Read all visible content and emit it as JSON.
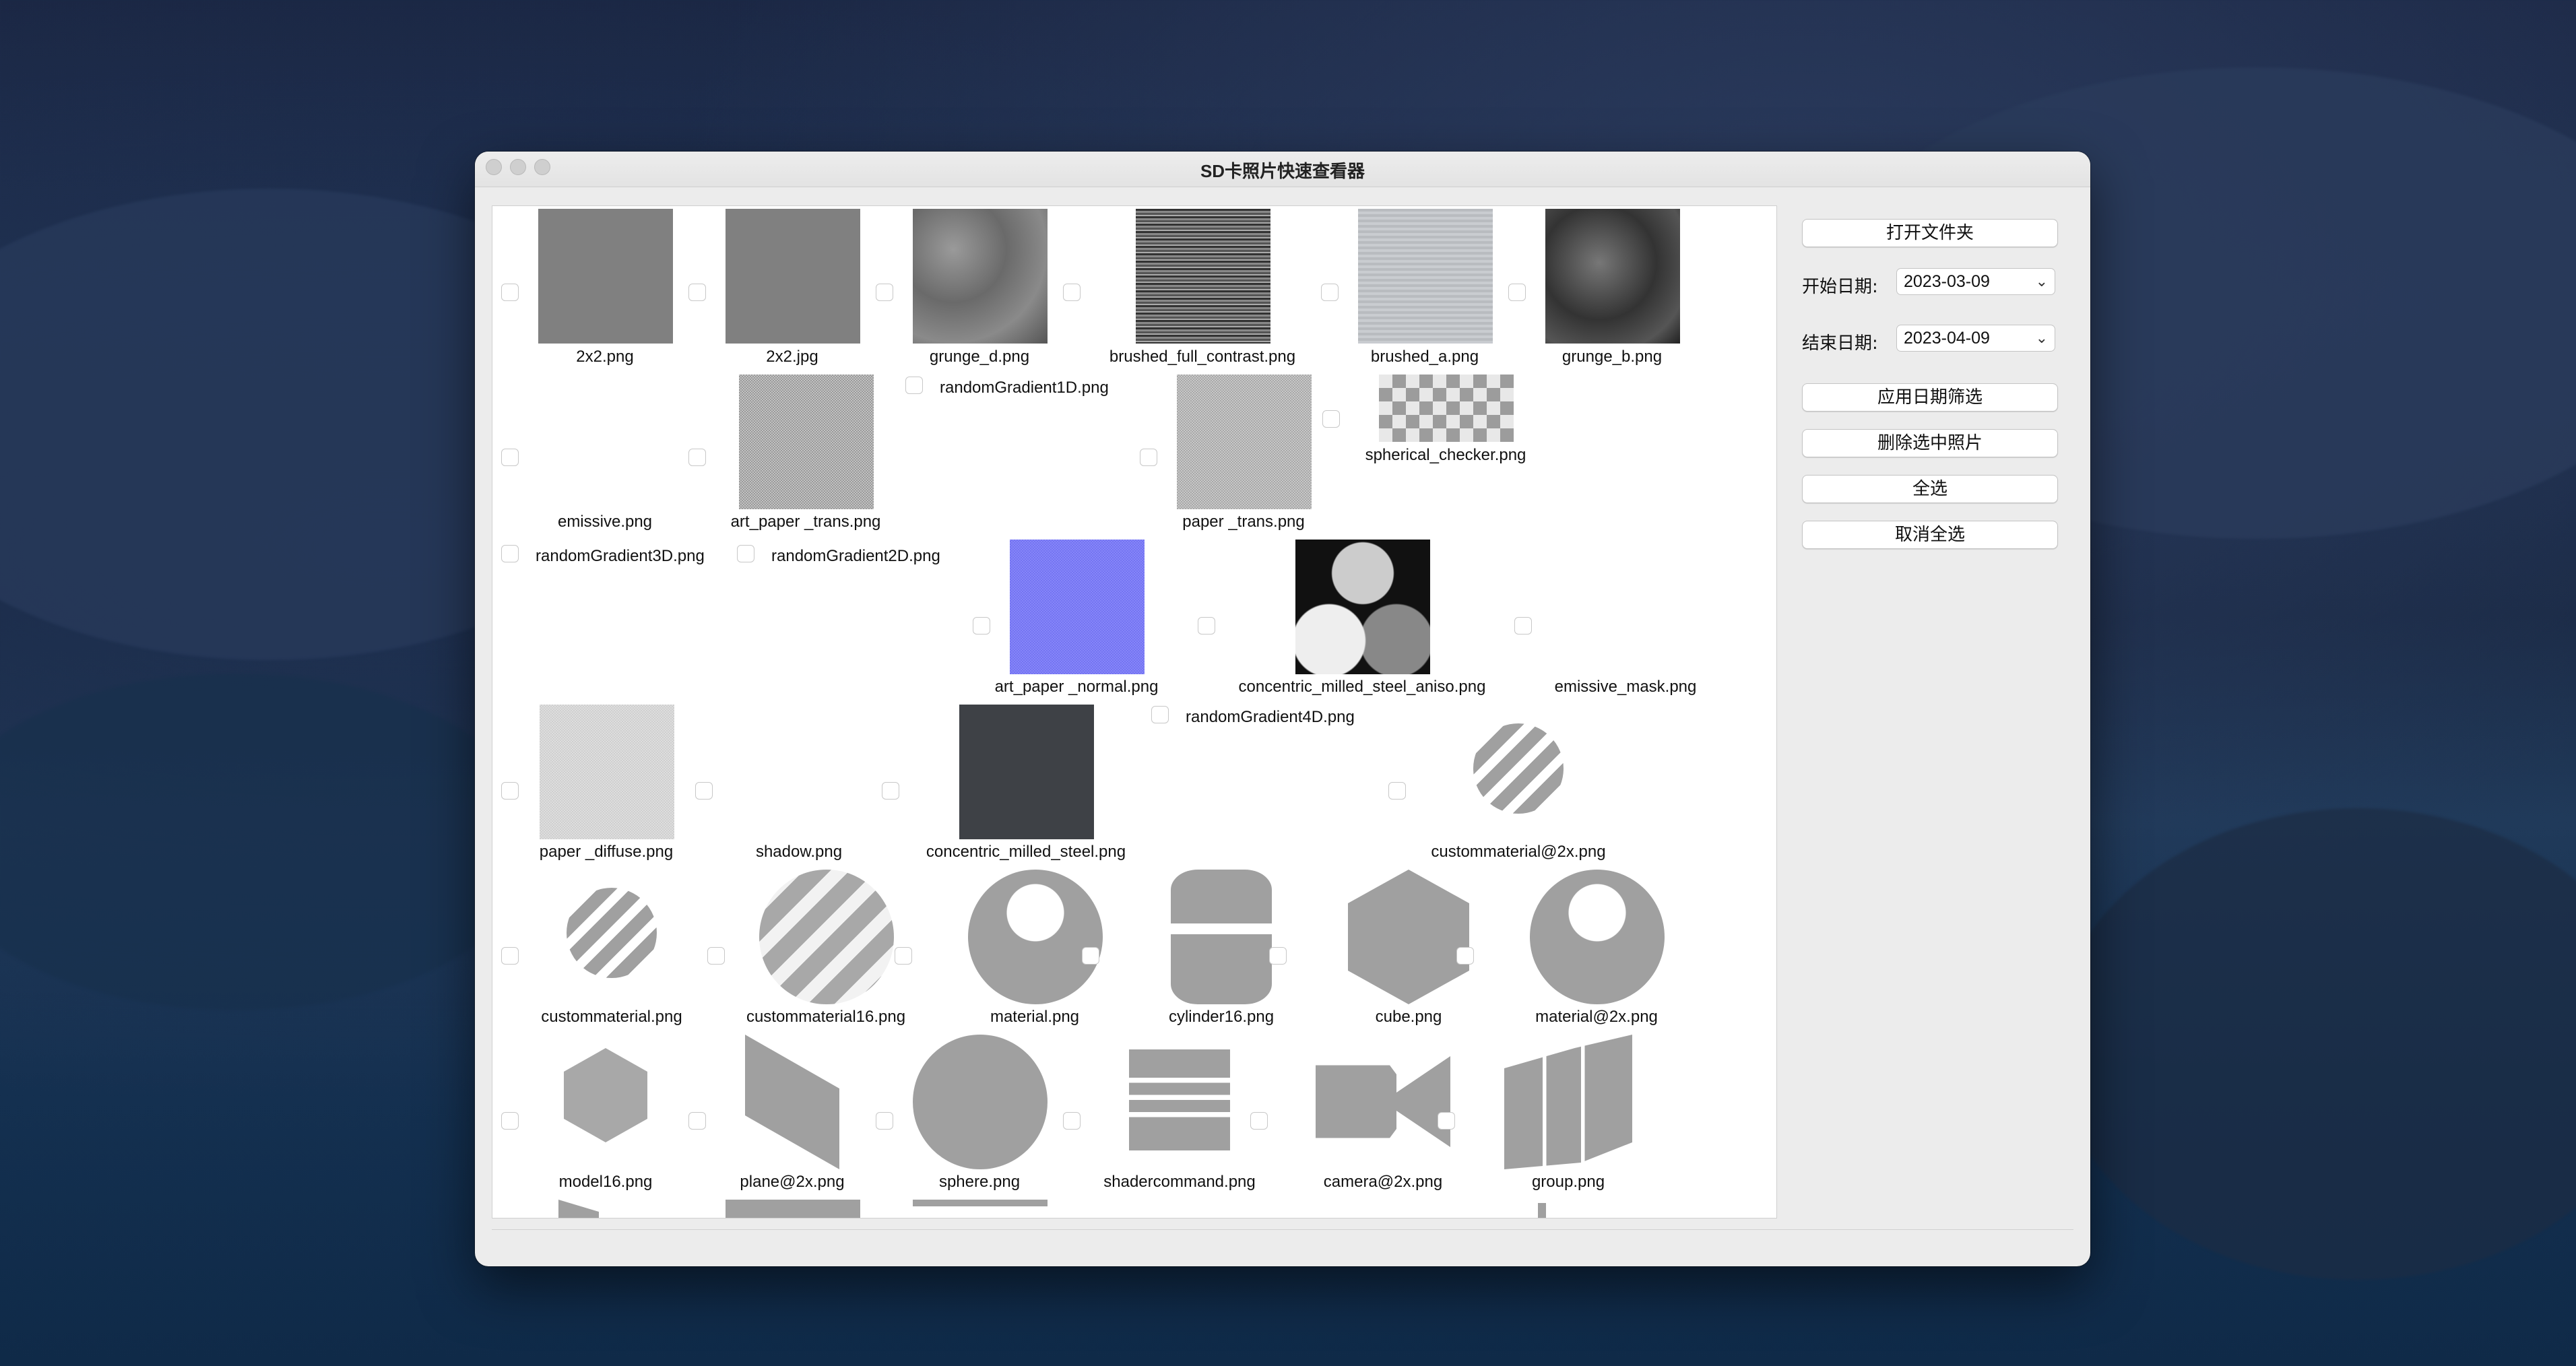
{
  "window": {
    "title": "SD卡照片快速查看器"
  },
  "controls": {
    "open_folder": "打开文件夹",
    "start_label": "开始日期:",
    "start_value": "2023-03-09",
    "end_label": "结束日期:",
    "end_value": "2023-04-09",
    "apply_filter": "应用日期筛选",
    "delete_selected": "删除选中照片",
    "select_all": "全选",
    "deselect_all": "取消全选"
  },
  "files": [
    "2x2.png",
    "2x2.jpg",
    "grunge_d.png",
    "brushed_full_contrast.png",
    "brushed_a.png",
    "grunge_b.png",
    "emissive.png",
    "art_paper _trans.png",
    "randomGradient1D.png",
    "paper _trans.png",
    "spherical_checker.png",
    "randomGradient3D.png",
    "randomGradient2D.png",
    "art_paper _normal.png",
    "concentric_milled_steel_aniso.png",
    "emissive_mask.png",
    "randomGradient4D.png",
    "paper _diffuse.png",
    "shadow.png",
    "concentric_milled_steel.png",
    "custommaterial@2x.png",
    "custommaterial.png",
    "custommaterial16.png",
    "material.png",
    "cylinder16.png",
    "cube.png",
    "material@2x.png",
    "model16.png",
    "plane@2x.png",
    "sphere.png",
    "shadercommand.png",
    "camera@2x.png",
    "group.png"
  ],
  "colors": {
    "accent_normal": "#7a7af4",
    "steel_dark": "#3e4146",
    "icon_gray": "#a0a0a0"
  }
}
